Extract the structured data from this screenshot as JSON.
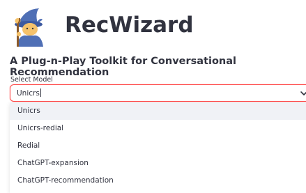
{
  "header": {
    "title": "RecWizard",
    "subtitle": "A Plug-n-Play Toolkit for Conversational Recommendation",
    "logo_icon": "wizard-emoji-icon"
  },
  "model_select": {
    "label": "Select Model",
    "value": "Unicrs",
    "options": [
      "Unicrs",
      "Unicrs-redial",
      "Redial",
      "ChatGPT-expansion",
      "ChatGPT-recommendation"
    ],
    "highlighted_index": 0
  },
  "colors": {
    "accent": "#ff4b4b",
    "text": "#31333f",
    "highlight": "#f0f2f6"
  }
}
